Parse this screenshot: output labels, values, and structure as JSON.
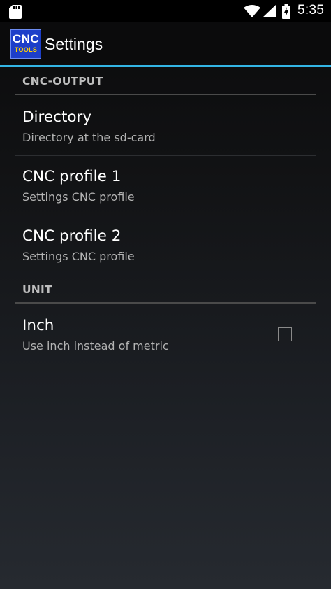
{
  "status_bar": {
    "time": "5:35",
    "icons": [
      "sd-card-icon",
      "wifi-icon",
      "cell-signal-icon",
      "battery-charging-icon"
    ]
  },
  "action_bar": {
    "logo": {
      "line1": "CNC",
      "line2": "TOOLS"
    },
    "title": "Settings",
    "accent_color": "#33b5e5"
  },
  "sections": [
    {
      "header": "CNC-OUTPUT",
      "items": [
        {
          "title": "Directory",
          "summary": "Directory at the sd-card"
        },
        {
          "title": "CNC profile 1",
          "summary": "Settings CNC profile"
        },
        {
          "title": "CNC profile 2",
          "summary": "Settings CNC profile"
        }
      ]
    },
    {
      "header": "UNIT",
      "items": [
        {
          "title": "Inch",
          "summary": "Use inch instead of metric",
          "checked": false
        }
      ]
    }
  ]
}
